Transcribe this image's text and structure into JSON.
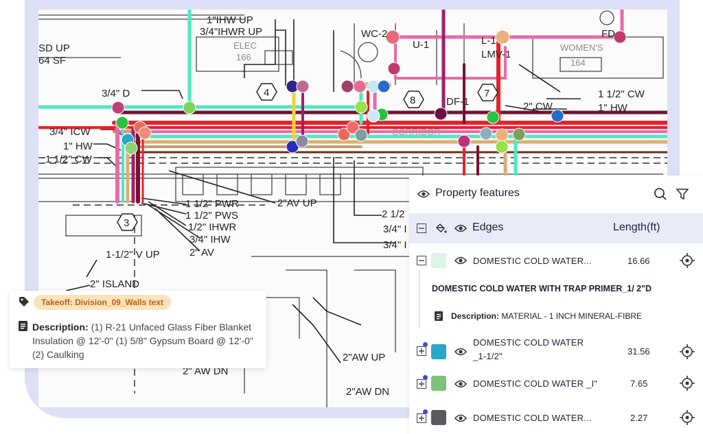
{
  "colors": {
    "frame": "#dde0f6",
    "cyan": "#4de8c4",
    "pink": "#e86aa8",
    "red": "#e8202a",
    "darkred": "#7a1030",
    "magenta": "#a0206a",
    "tan": "#d9b070",
    "green": "#6ecf4a",
    "accent_row": "#e9ebf9"
  },
  "drawing_labels": {
    "l1": "1\"IHW UP",
    "l2": "3/4\"IHWR UP",
    "l3": "SD UP",
    "l4": "64 SF",
    "l5": "ELEC",
    "l6": "166",
    "l7": "WC-2",
    "l8": "U-1",
    "l9": "L-1",
    "l10": "LMV-1",
    "l11": "WOMEN'S",
    "l12": "164",
    "l13": "FD",
    "l14": "3/4\" D",
    "l15": "4",
    "l16": "8",
    "l17": "7",
    "l18": "DF-1",
    "l19": "2\" CW",
    "l20": "1 1/2\" CW",
    "l21": "1\" HW",
    "l22": "CORRIDOR",
    "l23": "3/4\" ICW",
    "l24": "1\" HW",
    "l25": "1 1/2\" CW",
    "l26": "1 1/2\" PWR",
    "l27": "1 1/2\" PWS",
    "l28": "1/2\" IHWR",
    "l29": "3/4\" IHW",
    "l30": "2\" AV",
    "l31": "2\"AV UP",
    "l32": "3",
    "l33": "1-1/2\" V UP",
    "l34": "2\" ISLAND",
    "l35": "2 1/2",
    "l36": "3/4\" I",
    "l37": "3/4\" I",
    "l38": "2\"AW UP",
    "l39": "2\" AW DN",
    "l40": "2\"AW DN"
  },
  "panel": {
    "title": "Property features",
    "edges_label": "Edges",
    "length_header": "Length(ft)",
    "rows": [
      {
        "name": "DOMESTIC COLD WATER...",
        "value": "16.66",
        "color": "#d8f5e6"
      },
      {
        "name": "DOMESTIC COLD WATER",
        "name2": "_1-1/2\"",
        "value": "31.56",
        "color": "#2aa6c8"
      },
      {
        "name": "DOMESTIC COLD WATER _I\"",
        "value": "7.65",
        "color": "#7fc07a"
      },
      {
        "name": "DOMESTIC COLD WATER...",
        "value": "2.27",
        "color": "#5a5a5e"
      }
    ],
    "detail_title": "DOMESTIC COLD WATER WITH TRAP PRIMER_1/ 2\"D",
    "detail_desc_label": "Description:",
    "detail_desc_value": "MATERIAL - 1 INCH MINERAL-FIBRE"
  },
  "tooltip": {
    "tag": "Takeoff: Division_09_Walls text",
    "desc_label": "Description:",
    "desc_value": "(1) R-21 Unfaced Glass Fiber Blanket Insulation @ 12'-0\" (1) 5/8\" Gypsum Board @ 12'-0\" (2) Caulking"
  }
}
